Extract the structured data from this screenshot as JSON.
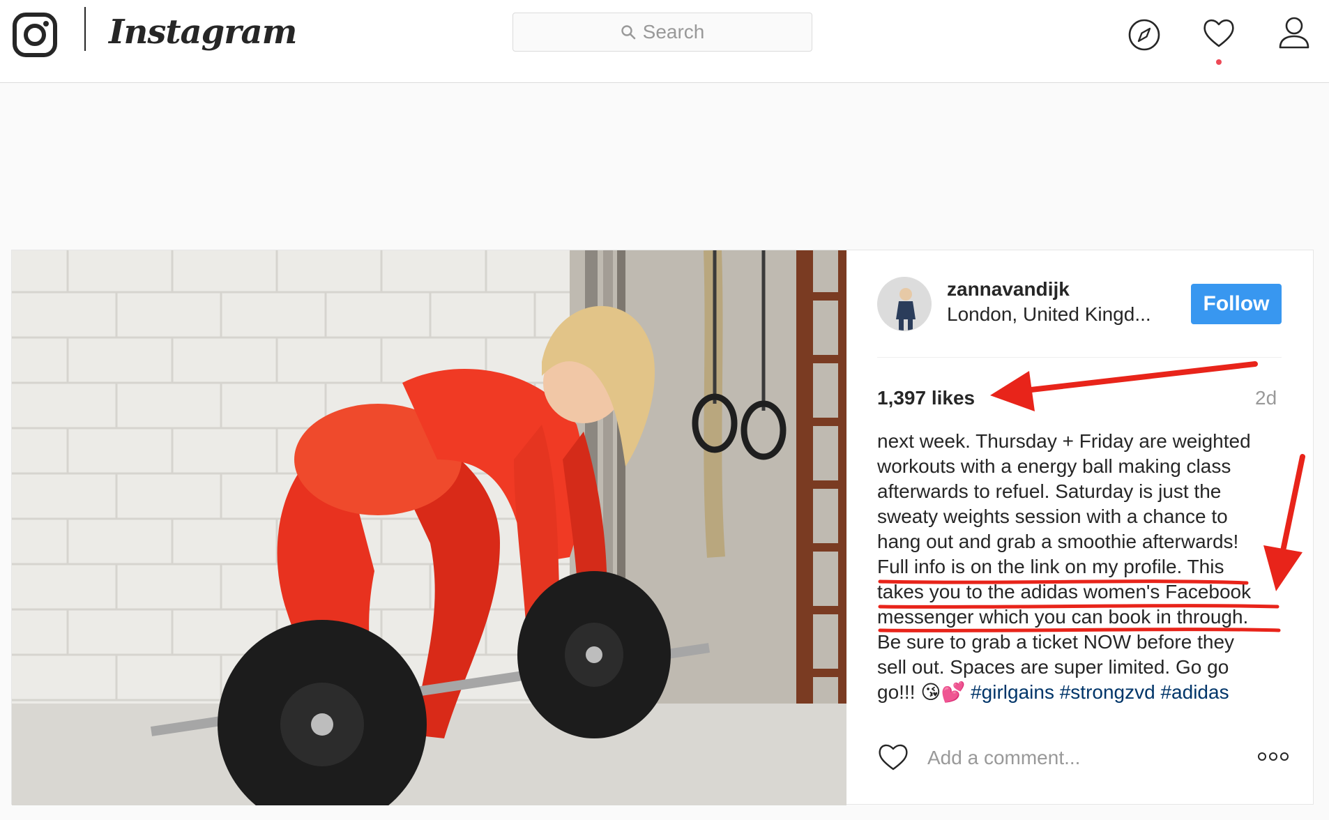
{
  "header": {
    "logo_icon": "instagram-camera-icon",
    "wordmark": "Instagram",
    "search": {
      "placeholder": "Search",
      "icon": "search-icon"
    },
    "nav_icons": [
      "compass-icon",
      "heart-icon",
      "person-icon"
    ],
    "notification_dot_color": "#ed4956"
  },
  "post": {
    "username": "zannavandijk",
    "location": "London, United Kingd...",
    "follow_label": "Follow",
    "likes": "1,397 likes",
    "time": "2d",
    "caption_lines": [
      "next week. Thursday + Friday are weighted",
      "workouts with a energy ball making class",
      "afterwards to refuel. Saturday is just the",
      "sweaty weights session with a chance to",
      "hang out and grab a smoothie afterwards!",
      "Full info is on the link on my profile. This",
      "takes you to the adidas women's Facebook",
      "messenger which you can book in through.",
      "Be sure to grab a ticket NOW before they",
      "sell out. Spaces are super limited. Go go"
    ],
    "caption_last_prefix": "go!!! 😘💕 ",
    "hashtags": [
      "#girlgains",
      "#strongzvd",
      "#adidas"
    ],
    "comment_placeholder": "Add a comment..."
  },
  "colors": {
    "follow_button": "#3897f0",
    "hashtag": "#003569",
    "annotation": "#e8241a",
    "muted_text": "#999999"
  }
}
